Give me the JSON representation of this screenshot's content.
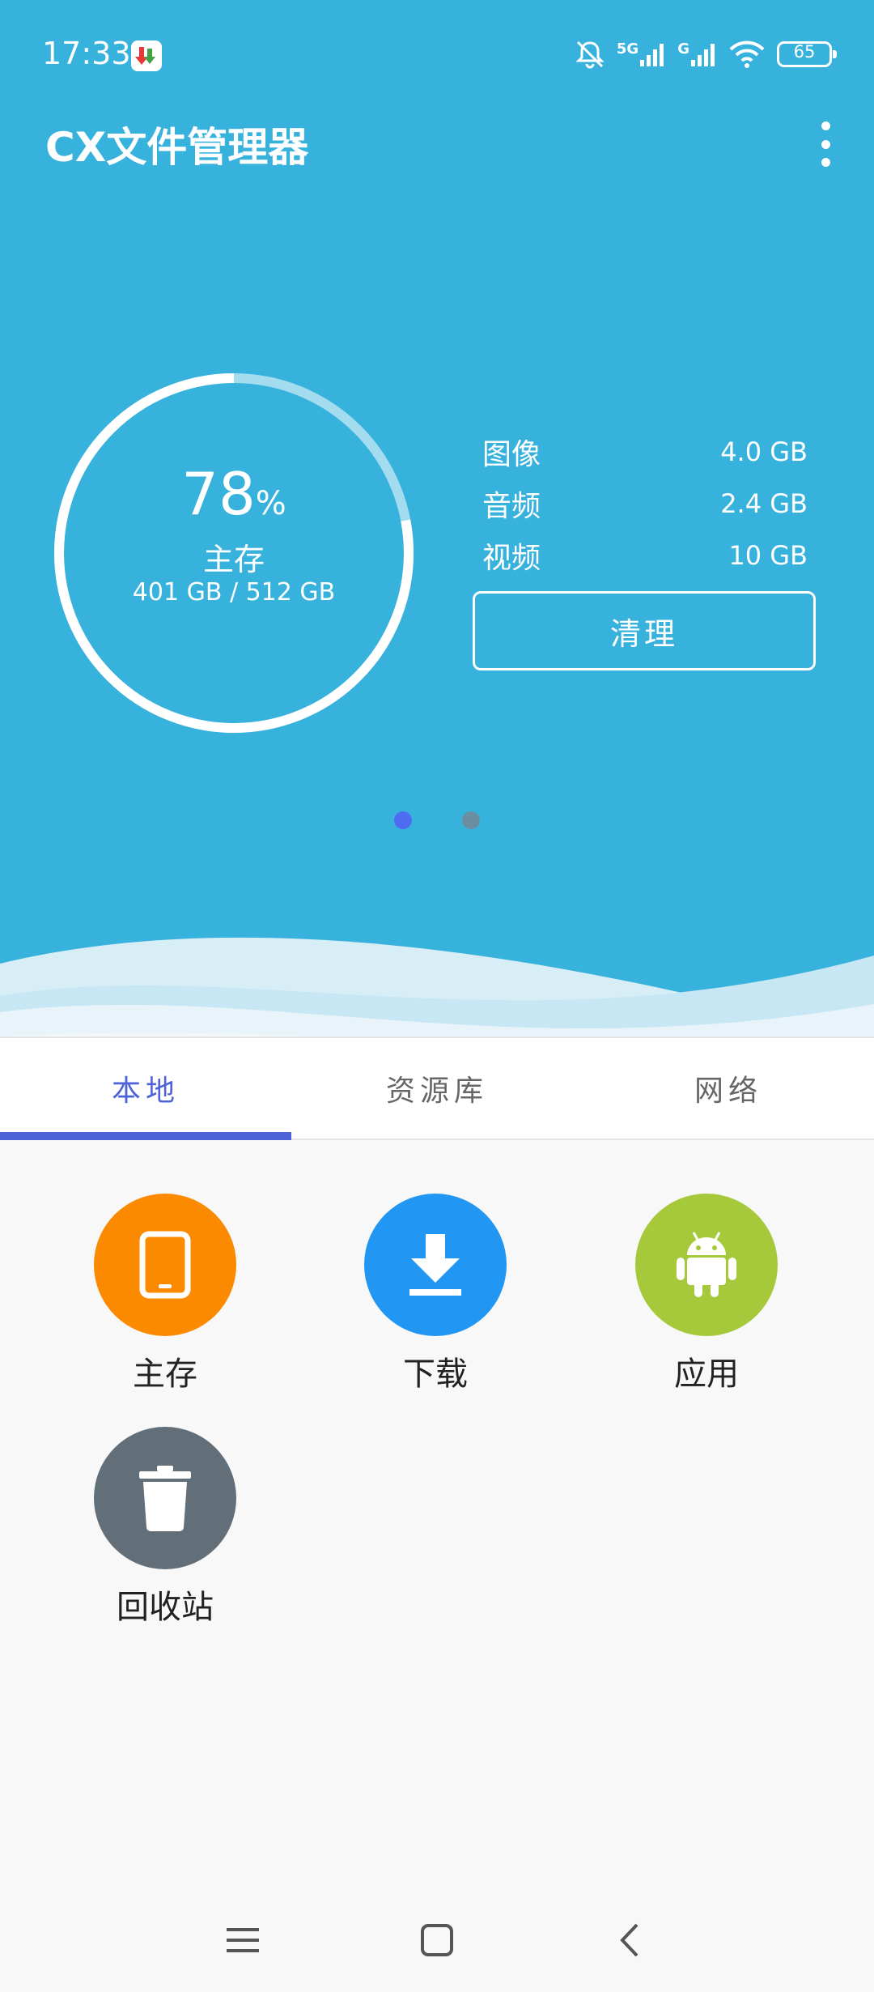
{
  "status_bar": {
    "time": "17:33",
    "network_5g": "5G",
    "network_g": "G",
    "battery": "65",
    "icons": [
      "app-notification-icon",
      "bell-muted-icon",
      "signal-icon",
      "wifi-icon",
      "battery-icon"
    ]
  },
  "header": {
    "title": "CX文件管理器",
    "menu_icon": "more-vert-icon"
  },
  "storage": {
    "percent": "78",
    "percent_sign": "%",
    "used_fraction": 0.78,
    "label": "主存",
    "usage": "401 GB / 512 GB",
    "categories": [
      {
        "name": "图像",
        "size": "4.0 GB"
      },
      {
        "name": "音频",
        "size": "2.4 GB"
      },
      {
        "name": "视频",
        "size": "10 GB"
      }
    ],
    "clean_label": "清理"
  },
  "pager": {
    "count": 2,
    "active_index": 0
  },
  "tabs": [
    {
      "label": "本地",
      "active": true
    },
    {
      "label": "资源库",
      "active": false
    },
    {
      "label": "网络",
      "active": false
    }
  ],
  "tiles": [
    {
      "label": "主存",
      "icon": "phone-icon",
      "color": "#fb8a00"
    },
    {
      "label": "下载",
      "icon": "download-icon",
      "color": "#2196f3"
    },
    {
      "label": "应用",
      "icon": "android-icon",
      "color": "#a5c93a"
    },
    {
      "label": "回收站",
      "icon": "trash-icon",
      "color": "#626e78"
    }
  ],
  "nav": {
    "icons": [
      "menu-icon",
      "home-icon",
      "back-icon"
    ]
  },
  "colors": {
    "hero": "#37b2dc",
    "accent": "#4e63d8",
    "dot_inactive": "#6b8fa0"
  }
}
